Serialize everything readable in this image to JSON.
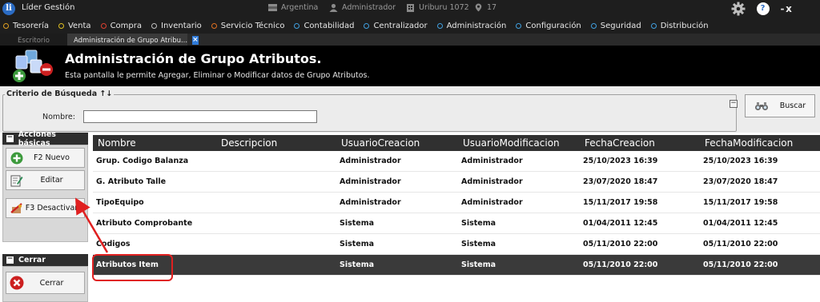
{
  "titlebar": {
    "app_title": "Líder Gestión",
    "logo_letter": "li",
    "country": "Argentina",
    "user": "Administrador",
    "branch": "Uriburu 1072",
    "location_num": "17",
    "help": "?",
    "minimize": "-",
    "close": "x"
  },
  "menu": [
    {
      "label": "Tesorería",
      "color": "#e0a020"
    },
    {
      "label": "Venta",
      "color": "#e0c020"
    },
    {
      "label": "Compra",
      "color": "#e04030"
    },
    {
      "label": "Inventario",
      "color": "#c0c0c0"
    },
    {
      "label": "Servicio Técnico",
      "color": "#e07020"
    },
    {
      "label": "Contabilidad",
      "color": "#40a0e0"
    },
    {
      "label": "Centralizador",
      "color": "#40a0e0"
    },
    {
      "label": "Administración",
      "color": "#40a0e0"
    },
    {
      "label": "Configuración",
      "color": "#40a0e0"
    },
    {
      "label": "Seguridad",
      "color": "#40a0e0"
    },
    {
      "label": "Distribución",
      "color": "#40a0e0"
    }
  ],
  "tabs": {
    "inactive": "Escritorio",
    "active": "Administración de Grupo Atribu...",
    "close": "×"
  },
  "header": {
    "title": "Administración de Grupo Atributos.",
    "subtitle": "Esta pantalla le permite Agregar, Eliminar o Modificar datos de Grupo Atributos."
  },
  "search": {
    "legend": "Criterio de Búsqueda ↑↓",
    "collapse": "−",
    "name_label": "Nombre:",
    "name_value": "",
    "button": "Buscar"
  },
  "sidebar": {
    "actions_title": "Acciones básicas",
    "actions": [
      {
        "label": "F2 Nuevo",
        "icon": "plus-icon"
      },
      {
        "label": "Editar",
        "icon": "edit-icon"
      },
      {
        "label": "F3 Desactivar",
        "icon": "deactivate-icon"
      }
    ],
    "close_title": "Cerrar",
    "close_label": "Cerrar"
  },
  "grid": {
    "columns": [
      "Nombre",
      "Descripcion",
      "UsuarioCreacion",
      "UsuarioModificacion",
      "FechaCreacion",
      "FechaModificacion"
    ],
    "rows": [
      [
        "Grup. Codigo Balanza",
        "",
        "Administrador",
        "Administrador",
        "25/10/2023 16:39",
        "25/10/2023 16:39"
      ],
      [
        "G. Atributo Talle",
        "",
        "Administrador",
        "Administrador",
        "23/07/2020 18:47",
        "23/07/2020 18:47"
      ],
      [
        "TipoEquipo",
        "",
        "Administrador",
        "Administrador",
        "15/11/2017 19:58",
        "15/11/2017 19:58"
      ],
      [
        "Atributo Comprobante",
        "",
        "Sistema",
        "Sistema",
        "01/04/2011 12:45",
        "01/04/2011 12:45"
      ],
      [
        "Codigos",
        "",
        "Sistema",
        "Sistema",
        "05/11/2010 22:00",
        "05/11/2010 22:00"
      ],
      [
        "Atributos Item",
        "",
        "Sistema",
        "Sistema",
        "05/11/2010 22:00",
        "05/11/2010 22:00"
      ]
    ],
    "selected_row": 5
  },
  "colors": {
    "accent": "#2b6cc4",
    "annotation": "#e02020",
    "dark": "#1e1e1e"
  }
}
